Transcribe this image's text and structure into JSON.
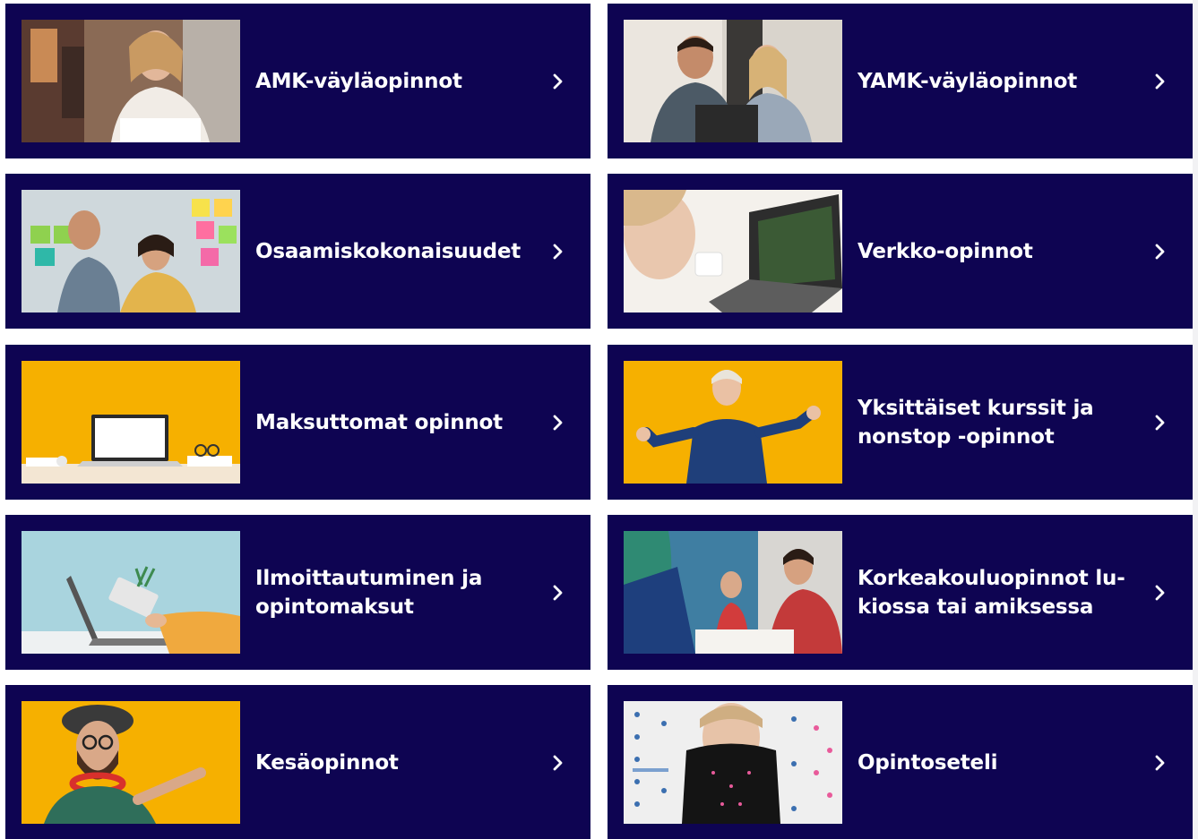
{
  "cards": [
    {
      "label": "AMK-väyläopinnot",
      "image": "woman-with-notebook-photo"
    },
    {
      "label": "YAMK-väyläopinnot",
      "image": "couple-with-laptop-photo"
    },
    {
      "label": "Osaamiskokonaisuudet",
      "image": "team-sticky-notes-photo"
    },
    {
      "label": "Verkko-opinnot",
      "image": "woman-at-laptop-photo"
    },
    {
      "label": "Maksuttomat opinnot",
      "image": "laptop-on-desk-photo"
    },
    {
      "label": "Yksittäiset kurssit ja nonstop -opinnot",
      "image": "excited-woman-photo"
    },
    {
      "label": "Ilmoittautuminen ja opintomaksut",
      "image": "laptop-calculator-photo"
    },
    {
      "label": "Korkeakouluopinnot lu-kiossa tai amiksessa",
      "image": "students-classroom-photo"
    },
    {
      "label": "Kesäopinnot",
      "image": "man-pointing-photo"
    },
    {
      "label": "Opintoseteli",
      "image": "woman-turtleneck-photo"
    }
  ],
  "colors": {
    "card_bg": "#0e0452",
    "text": "#ffffff",
    "accent_yellow": "#f6b000"
  },
  "icons": {
    "chevron": "chevron-right-icon"
  }
}
